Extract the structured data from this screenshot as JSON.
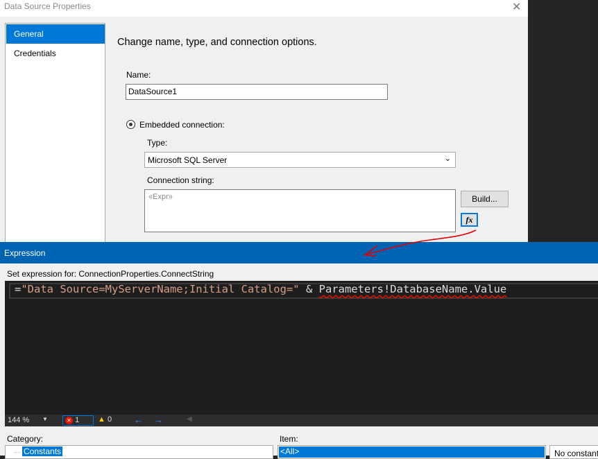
{
  "dialog": {
    "title": "Data Source Properties",
    "close_icon": "close-icon",
    "sidebar": [
      {
        "label": "General",
        "selected": true
      },
      {
        "label": "Credentials",
        "selected": false
      }
    ],
    "heading": "Change name, type, and connection options.",
    "name_label": "Name:",
    "name_value": "DataSource1",
    "embedded_label": "Embedded connection:",
    "embedded_checked": true,
    "type_label": "Type:",
    "type_value": "Microsoft SQL Server",
    "conn_label": "Connection string:",
    "conn_value": "«Expr»",
    "build_label": "Build...",
    "fx_label": "fx"
  },
  "expression": {
    "title": "Expression",
    "set_for": "Set expression for: ConnectionProperties.ConnectString",
    "code": {
      "eq": "=",
      "str": "\"Data Source=MyServerName;Initial Catalog=\"",
      "op": " & ",
      "ref": "Parameters!DatabaseName.Value"
    },
    "zoom": "144 %",
    "errors": "1",
    "warnings": "0",
    "category_label": "Category:",
    "category_selected": "Constants",
    "item_label": "Item:",
    "item_selected": "<All>",
    "desc": "No constant"
  },
  "colors": {
    "accent": "#0078d7",
    "title_bar": "#0063b1",
    "annotation": "#e00000"
  }
}
